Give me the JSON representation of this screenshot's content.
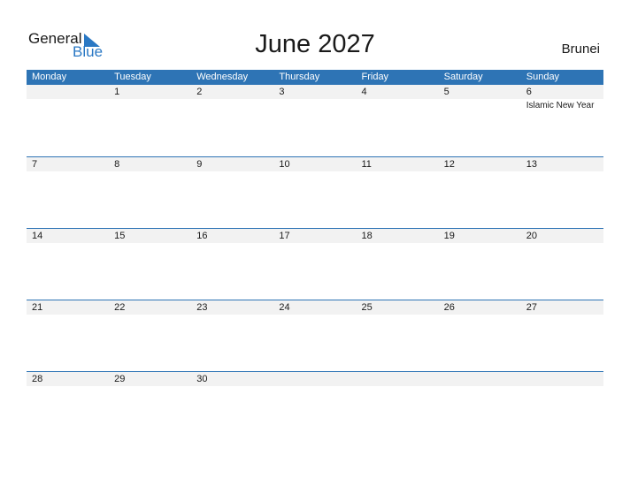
{
  "logo": {
    "line1": "General",
    "line2": "Blue"
  },
  "title": "June 2027",
  "country": "Brunei",
  "colors": {
    "accent": "#2e74b5",
    "band": "#f2f2f2"
  },
  "weekdays": [
    "Monday",
    "Tuesday",
    "Wednesday",
    "Thursday",
    "Friday",
    "Saturday",
    "Sunday"
  ],
  "weeks": [
    {
      "days": [
        "",
        "1",
        "2",
        "3",
        "4",
        "5",
        "6"
      ],
      "events": [
        "",
        "",
        "",
        "",
        "",
        "",
        "Islamic New Year"
      ]
    },
    {
      "days": [
        "7",
        "8",
        "9",
        "10",
        "11",
        "12",
        "13"
      ],
      "events": [
        "",
        "",
        "",
        "",
        "",
        "",
        ""
      ]
    },
    {
      "days": [
        "14",
        "15",
        "16",
        "17",
        "18",
        "19",
        "20"
      ],
      "events": [
        "",
        "",
        "",
        "",
        "",
        "",
        ""
      ]
    },
    {
      "days": [
        "21",
        "22",
        "23",
        "24",
        "25",
        "26",
        "27"
      ],
      "events": [
        "",
        "",
        "",
        "",
        "",
        "",
        ""
      ]
    },
    {
      "days": [
        "28",
        "29",
        "30",
        "",
        "",
        "",
        ""
      ],
      "events": [
        "",
        "",
        "",
        "",
        "",
        "",
        ""
      ]
    }
  ]
}
